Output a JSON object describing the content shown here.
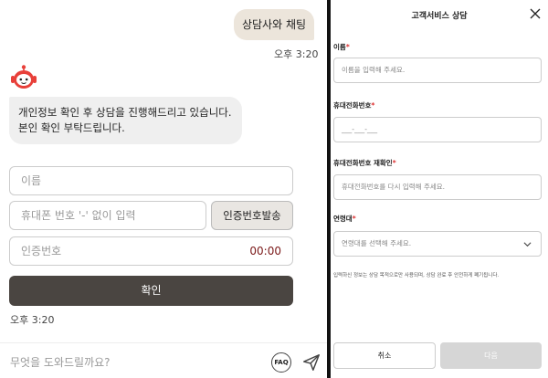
{
  "chat": {
    "user_message": "상담사와 채팅",
    "user_time": "오후 3:20",
    "bot_message_line1": "개인정보 확인 후 상담을 진행해드리고 있습니다.",
    "bot_message_line2": "본인 확인 부탁드립니다.",
    "form": {
      "name_placeholder": "이름",
      "phone_placeholder": "휴대폰 번호 '-' 없이 입력",
      "send_code_label": "인증번호발송",
      "code_placeholder": "인증번호",
      "timer": "00:00",
      "confirm_label": "확인"
    },
    "bot_time": "오후 3:20",
    "composer_placeholder": "무엇을 도와드릴까요?",
    "faq_label": "FAQ"
  },
  "modal": {
    "title": "고객서비스 상담",
    "name_label": "이름",
    "name_placeholder": "이름을 입력해 주세요.",
    "phone_label": "휴대전화번호",
    "phone_placeholder": "___-___-___",
    "phone_confirm_label": "휴대전화번호 재확인",
    "phone_confirm_placeholder": "휴대전화번호를 다시 입력해 주세요.",
    "age_label": "연령대",
    "age_placeholder": "연령대를 선택해 주세요.",
    "required_mark": "*",
    "notice": "입력하신 정보는 상담 목적으로만 사용되며, 상담 완료 후 안전하게 폐기됩니다.",
    "cancel_label": "취소",
    "next_label": "다음"
  },
  "colors": {
    "confirm_button": "#4a4541",
    "user_bubble": "#ece5db",
    "timer": "#7a1818",
    "required": "#dd3333",
    "next_disabled": "#d6d6d6",
    "avatar": "#e8403a"
  },
  "icons": [
    "robot-avatar-icon",
    "faq-icon",
    "send-icon",
    "close-icon",
    "chevron-down-icon"
  ]
}
